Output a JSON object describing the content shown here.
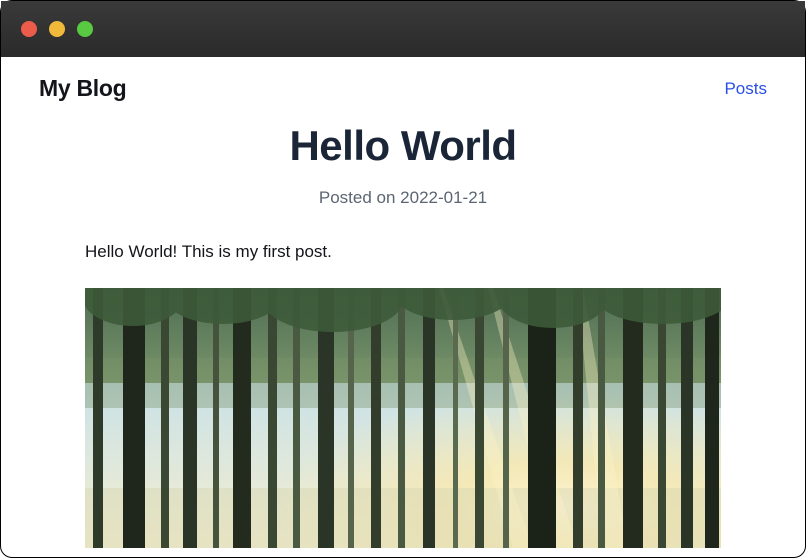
{
  "header": {
    "site_title": "My Blog",
    "nav": {
      "posts_label": "Posts"
    }
  },
  "post": {
    "title": "Hello World",
    "meta_prefix": "Posted on ",
    "date": "2022-01-21",
    "body": "Hello World! This is my first post.",
    "image_alt": "forest with sunlight through trees"
  }
}
